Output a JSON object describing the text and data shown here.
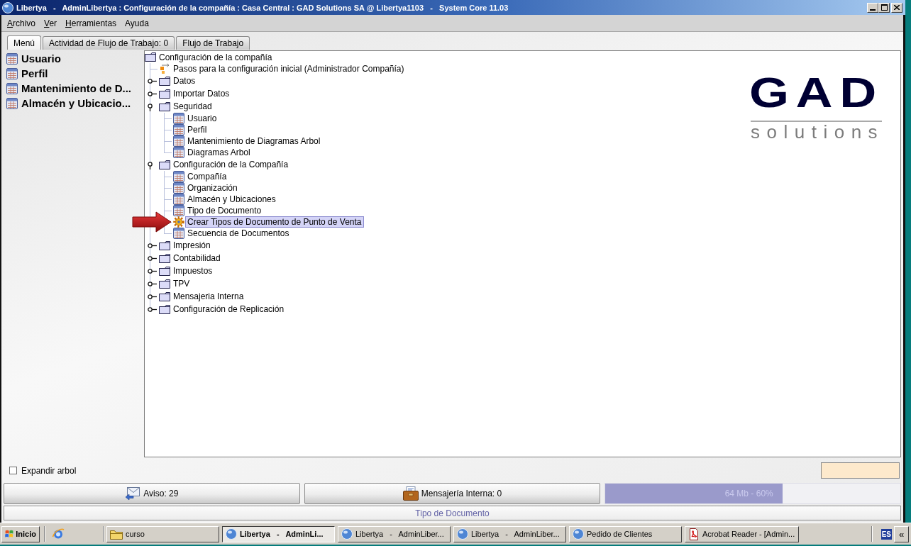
{
  "window": {
    "title": "Libertya   -   AdminLibertya : Configuración de la compañía : Casa Central : GAD Solutions SA @ Libertya1103   -   System Core 11.03"
  },
  "menu": [
    {
      "label": "Archivo",
      "mnemonic": true
    },
    {
      "label": "Ver",
      "mnemonic": true
    },
    {
      "label": "Herramientas",
      "mnemonic": true
    },
    {
      "label": "Ayuda",
      "mnemonic": false
    }
  ],
  "tabs": [
    {
      "label": "Menú",
      "selected": true
    },
    {
      "label": "Actividad de Flujo de Trabajo: 0",
      "selected": false
    },
    {
      "label": "Flujo de Trabajo",
      "selected": false
    }
  ],
  "favorites": [
    {
      "label": "Usuario"
    },
    {
      "label": "Perfil"
    },
    {
      "label": "Mantenimiento de D..."
    },
    {
      "label": "Almacén y Ubicacio..."
    }
  ],
  "tree": {
    "label": "Configuración de la compañía",
    "kind": "folder",
    "selected": false,
    "children": [
      {
        "label": "Pasos para la configuración inicial (Administrador Compañía)",
        "kind": "workflow",
        "selected": false
      },
      {
        "label": "Datos",
        "kind": "folder",
        "expanded": false,
        "selected": false
      },
      {
        "label": "Importar Datos",
        "kind": "folder",
        "expanded": false,
        "selected": false
      },
      {
        "label": "Seguridad",
        "kind": "folder",
        "expanded": true,
        "selected": false,
        "children": [
          {
            "label": "Usuario",
            "kind": "window",
            "selected": false
          },
          {
            "label": "Perfil",
            "kind": "window",
            "selected": false
          },
          {
            "label": "Mantenimiento de Diagramas Arbol",
            "kind": "window",
            "selected": false
          },
          {
            "label": "Diagramas Arbol",
            "kind": "window",
            "selected": false
          }
        ]
      },
      {
        "label": "Configuración de la Compañía",
        "kind": "folder",
        "expanded": true,
        "selected": false,
        "children": [
          {
            "label": "Compañía",
            "kind": "window",
            "selected": false
          },
          {
            "label": "Organización",
            "kind": "window",
            "selected": false
          },
          {
            "label": "Almacén y Ubicaciones",
            "kind": "window",
            "selected": false
          },
          {
            "label": "Tipo de Documento",
            "kind": "window",
            "selected": false
          },
          {
            "label": "Crear Tipos de Documento de Punto de Venta",
            "kind": "process",
            "selected": true
          },
          {
            "label": "Secuencia de Documentos",
            "kind": "window",
            "selected": false
          }
        ]
      },
      {
        "label": "Impresión",
        "kind": "folder",
        "expanded": false,
        "selected": false
      },
      {
        "label": "Contabilidad",
        "kind": "folder",
        "expanded": false,
        "selected": false
      },
      {
        "label": "Impuestos",
        "kind": "folder",
        "expanded": false,
        "selected": false
      },
      {
        "label": "TPV",
        "kind": "folder",
        "expanded": false,
        "selected": false
      },
      {
        "label": "Mensajeria Interna",
        "kind": "folder",
        "expanded": false,
        "selected": false
      },
      {
        "label": "Configuración de Replicación",
        "kind": "folder",
        "expanded": false,
        "selected": false
      }
    ]
  },
  "logo": {
    "mark": "GAD",
    "tagline": "solutions"
  },
  "expand_tree": {
    "label": "Expandir arbol",
    "checked": false
  },
  "status_buttons": [
    {
      "kind": "notices",
      "label": "Aviso: 29"
    },
    {
      "kind": "messages",
      "label": "Mensajería Interna: 0"
    }
  ],
  "memory": {
    "level": 0.6,
    "reading": "64 Mb - 60%"
  },
  "status_bar": {
    "message": "Tipo de Documento"
  },
  "taskbar": {
    "start": "Inicio",
    "tasks": [
      {
        "label": "curso",
        "kind": "folder",
        "selected": false
      },
      {
        "label": "Libertya   -   AdminLi...",
        "kind": "app",
        "selected": true
      },
      {
        "label": "Libertya   -   AdminLiber...",
        "kind": "app",
        "selected": false
      },
      {
        "label": "Libertya   -   AdminLiber...",
        "kind": "app",
        "selected": false
      },
      {
        "label": "Pedido de Clientes",
        "kind": "app",
        "selected": false
      },
      {
        "label": "Acrobat Reader - [Admin...",
        "kind": "pdf",
        "selected": false
      }
    ],
    "language": "ES",
    "tray_toggle": "«"
  }
}
